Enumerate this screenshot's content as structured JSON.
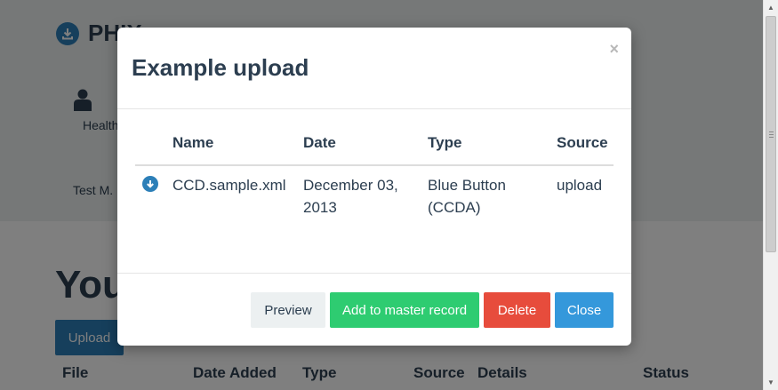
{
  "background": {
    "brand": "PHIX",
    "health_link": "Health",
    "test_user": "Test M.",
    "heading": "You",
    "upload_button": "Upload",
    "table_headers": [
      "File",
      "Date Added",
      "Type",
      "Source",
      "Details",
      "Status"
    ]
  },
  "modal": {
    "title": "Example upload",
    "close_symbol": "×",
    "table": {
      "headers": [
        "Name",
        "Date",
        "Type",
        "Source"
      ],
      "rows": [
        {
          "name": "CCD.sample.xml",
          "date": "December 03, 2013",
          "type": "Blue Button (CCDA)",
          "source": "upload"
        }
      ]
    },
    "buttons": {
      "preview": "Preview",
      "add_to_master": "Add to master record",
      "delete": "Delete",
      "close": "Close"
    }
  },
  "colors": {
    "primary": "#2c7fb8",
    "success": "#2ecc71",
    "danger": "#e74c3c",
    "info": "#3498db",
    "text": "#2c3e50"
  },
  "icons": [
    "download-circle-icon",
    "person-icon",
    "close-icon"
  ]
}
